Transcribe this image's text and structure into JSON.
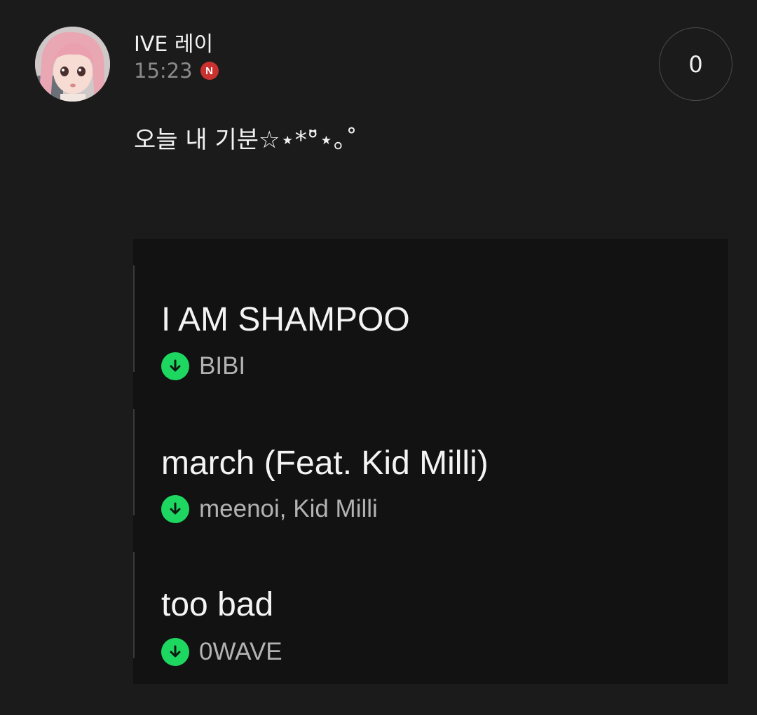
{
  "post": {
    "author": "IVE 레이",
    "time": "15:23",
    "new_badge": "N",
    "like_count": "0",
    "text": "오늘 내 기분☆⋆*°̈⋆｡˚"
  },
  "tracks": [
    {
      "title": "I AM SHAMPOO",
      "artist": "BIBI"
    },
    {
      "title": "march (Feat. Kid Milli)",
      "artist": "meenoi, Kid Milli"
    },
    {
      "title": "too bad",
      "artist": "0WAVE"
    }
  ],
  "colors": {
    "background": "#1b1b1c",
    "badge": "#c9322e",
    "download_green": "#1ed760"
  },
  "icons": {
    "download": "download-circle-icon",
    "new": "new-badge-icon"
  }
}
